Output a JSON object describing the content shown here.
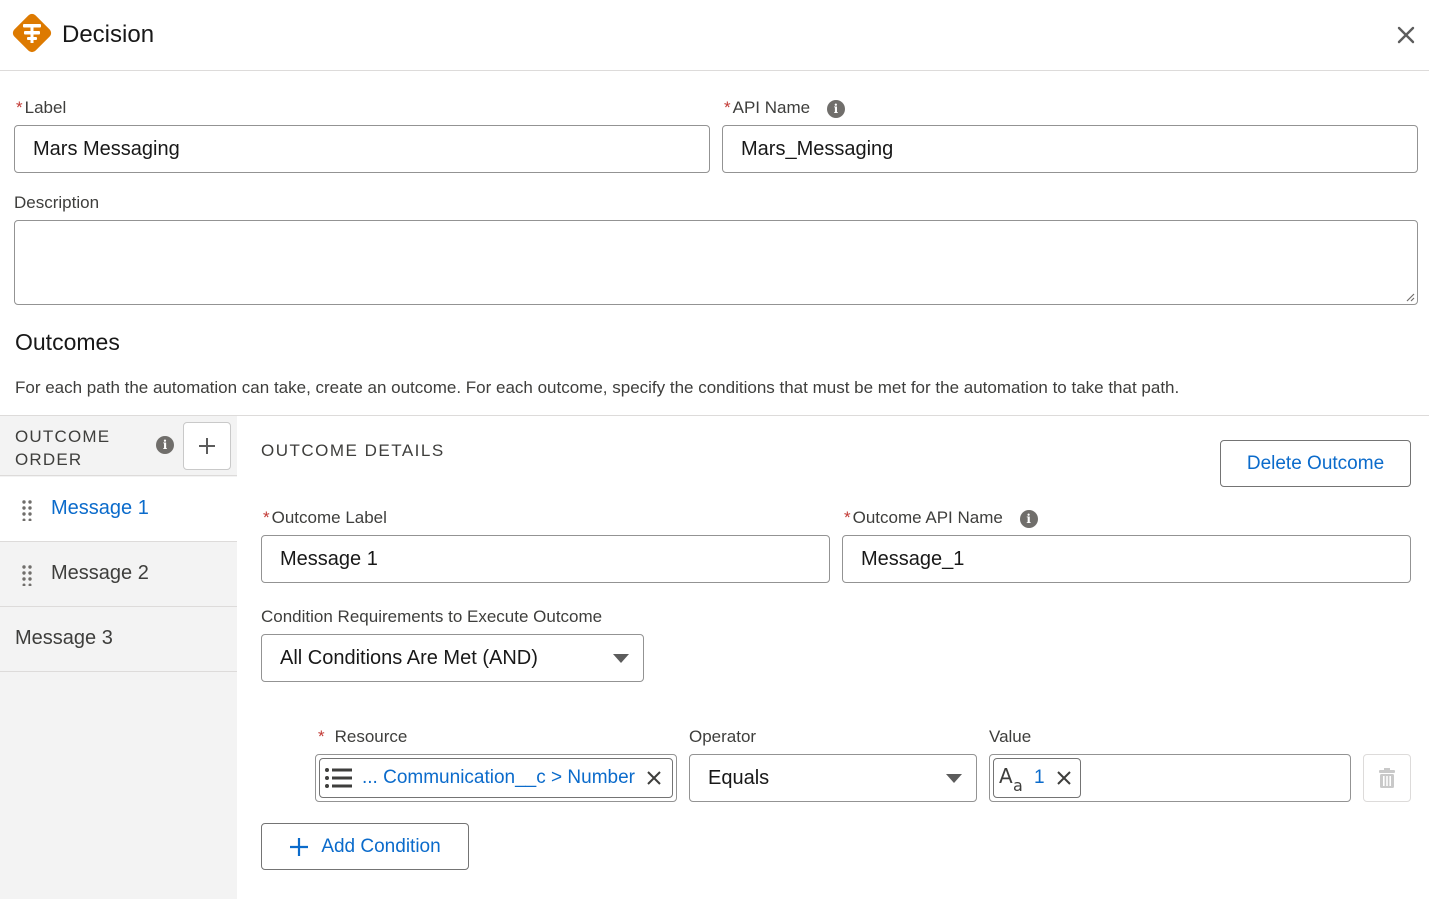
{
  "header": {
    "title": "Decision",
    "accent": "#dd7a01"
  },
  "form": {
    "label": {
      "label": "Label",
      "value": "Mars Messaging"
    },
    "api_name": {
      "label": "API Name",
      "value": "Mars_Messaging"
    },
    "description": {
      "label": "Description",
      "value": ""
    }
  },
  "outcomes": {
    "title": "Outcomes",
    "description": "For each path the automation can take, create an outcome. For each outcome, specify the conditions that must be met for the automation to take that path."
  },
  "sidebar": {
    "heading_line1": "OUTCOME",
    "heading_line2": "ORDER",
    "items": [
      {
        "label": "Message 1",
        "active": true
      },
      {
        "label": "Message 2",
        "active": false
      },
      {
        "label": "Message 3",
        "active": false
      }
    ]
  },
  "details": {
    "title": "OUTCOME DETAILS",
    "delete_label": "Delete Outcome",
    "outcome_label": {
      "label": "Outcome Label",
      "value": "Message 1"
    },
    "outcome_api_name": {
      "label": "Outcome API Name",
      "value": "Message_1"
    },
    "condition_req": {
      "label": "Condition Requirements to Execute Outcome",
      "value": "All Conditions Are Met (AND)"
    },
    "condition": {
      "resource_label": "Resource",
      "resource_value": "... Communication__c > Number",
      "operator_label": "Operator",
      "operator_value": "Equals",
      "value_label": "Value",
      "value_value": "1"
    },
    "add_condition_label": "Add Condition"
  }
}
